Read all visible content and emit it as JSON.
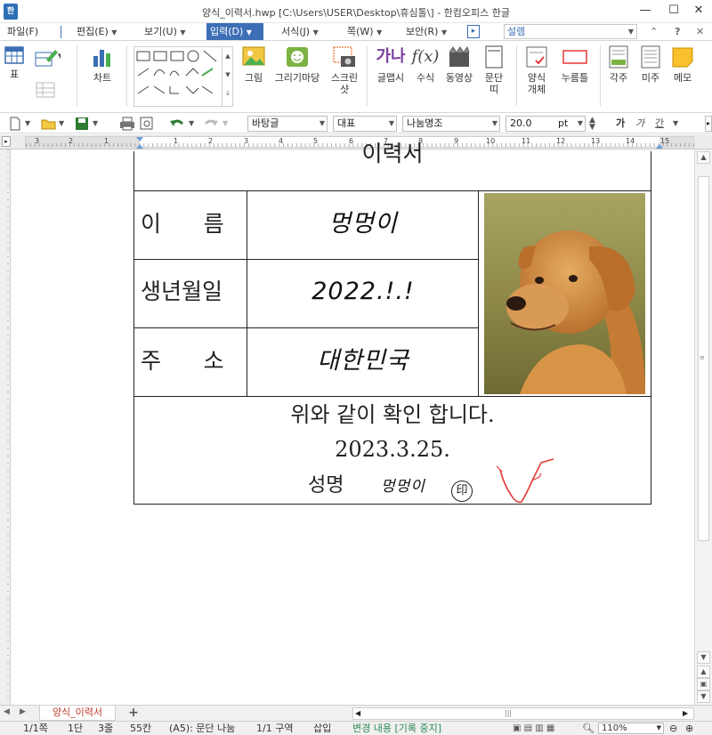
{
  "window": {
    "title": "양식_이력서.hwp [C:\\Users\\USER\\Desktop\\휴심톨\\] - 한컴오피스 한글",
    "app_icon_glyph": "한",
    "minimize": "—",
    "maximize": "☐",
    "close": "✕"
  },
  "menu": {
    "items": [
      {
        "label": "파일(F)"
      },
      {
        "label": "편집(E)"
      },
      {
        "label": "보기(U)"
      },
      {
        "label": "입력(D)"
      },
      {
        "label": "서식(J)"
      },
      {
        "label": "쪽(W)"
      },
      {
        "label": "보안(R)"
      }
    ],
    "search_value": "설렘",
    "more_glyph": "▸",
    "help": "?",
    "collapse": "⌃",
    "close": "✕"
  },
  "ribbon": {
    "table": "표",
    "chart": "차트",
    "picture": "그림",
    "drawing_market": "그리기마당",
    "screenshot": "스크린\n샷",
    "glyph": "글맵시",
    "formula": "수식",
    "video": "동영상",
    "paragraph": "문단\n띠",
    "form_object": "양식\n개체",
    "button": "누름틀",
    "footnote": "각주",
    "endnote": "미주",
    "memo": "메모",
    "glyph_icon_text": "가나"
  },
  "format_bar": {
    "style": "바탕글",
    "lang": "대표",
    "font": "나눔명조",
    "size": "20.0",
    "unit": "pt",
    "bold": "가",
    "italic": "가",
    "underline": "간"
  },
  "ruler": {
    "numbers": [
      "3",
      "2",
      "1",
      "1",
      "2",
      "3",
      "4",
      "5",
      "6",
      "7",
      "8",
      "9",
      "10",
      "11",
      "12",
      "13",
      "14",
      "15"
    ]
  },
  "document": {
    "heading": "이력서",
    "name_label": "이      름",
    "name_value": "멍멍이",
    "birth_label": "생년월일",
    "birth_value": "2022.!.!",
    "address_label": "주      소",
    "address_value": "대한민국",
    "confirm_text": "위와 같이 확인 합니다.",
    "date": "2023.3.25.",
    "sign_label": "성명",
    "sign_name": "멍멍이",
    "seal": "印"
  },
  "tabs": {
    "doc_tab": "양식_이력서",
    "add_tab": "+"
  },
  "status": {
    "page": "1/1쪽",
    "column": "1단",
    "line": "3줄",
    "char": "55칸",
    "para": "(A5): 문단 나눔",
    "section": "1/1 구역",
    "insert": "삽입",
    "track": "변경 내용 [기록 중지]",
    "zoom": "110%"
  },
  "colors": {
    "accent": "#3d6fb7",
    "tab_text": "#c0392b",
    "track_text": "#2e8b57",
    "signature": "#e53935"
  }
}
